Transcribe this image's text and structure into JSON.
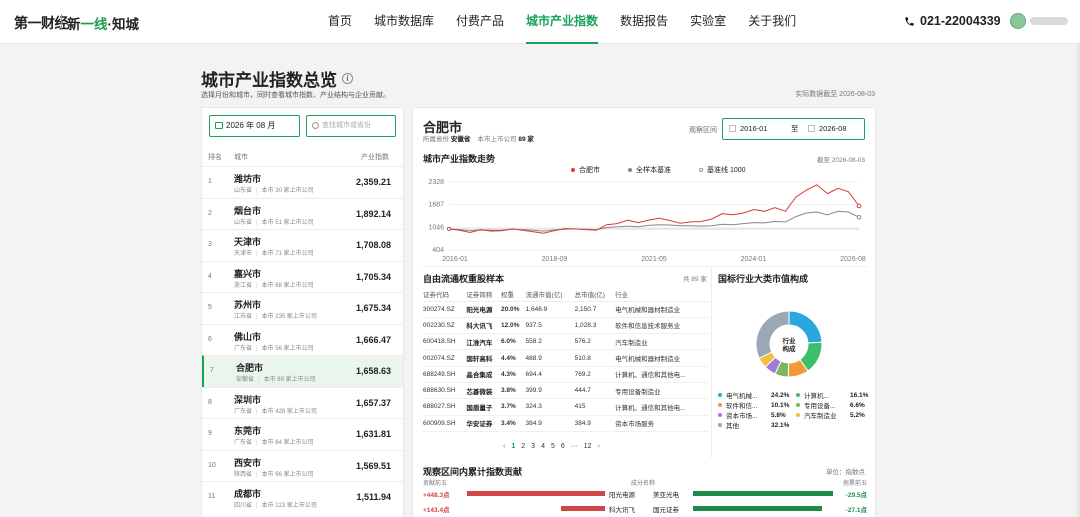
{
  "nav": {
    "logo_a": "第一财经",
    "logo_b_pre": "新",
    "logo_b_green": "一线",
    "logo_b_post": "·知城",
    "links": [
      "首页",
      "城市数据库",
      "付费产品",
      "城市产业指数",
      "数据报告",
      "实验室",
      "关于我们"
    ],
    "active_index": 3,
    "phone": "021-22004339"
  },
  "page": {
    "title": "城市产业指数总览",
    "subtitle": "选择月份和城市，同时查看城市指数、产业结构与企业贡献。",
    "data_date": "实际数据截至 2026-08-03"
  },
  "left": {
    "month": "2026 年 08 月",
    "search_placeholder": "查找城市或省份",
    "head": {
      "rank": "排名",
      "city": "城市",
      "index": "产业指数"
    },
    "rows": [
      {
        "rank": "1",
        "city": "潍坊市",
        "prov": "山东省",
        "count": "本市 30 家上市公司",
        "value": "2,359.21"
      },
      {
        "rank": "2",
        "city": "烟台市",
        "prov": "山东省",
        "count": "本市 51 家上市公司",
        "value": "1,892.14"
      },
      {
        "rank": "3",
        "city": "天津市",
        "prov": "天津市",
        "count": "本市 71 家上市公司",
        "value": "1,708.08"
      },
      {
        "rank": "4",
        "city": "嘉兴市",
        "prov": "浙江省",
        "count": "本市 68 家上市公司",
        "value": "1,705.34"
      },
      {
        "rank": "5",
        "city": "苏州市",
        "prov": "江苏省",
        "count": "本市 235 家上市公司",
        "value": "1,675.34"
      },
      {
        "rank": "6",
        "city": "佛山市",
        "prov": "广东省",
        "count": "本市 56 家上市公司",
        "value": "1,666.47"
      },
      {
        "rank": "7",
        "city": "合肥市",
        "prov": "安徽省",
        "count": "本市 89 家上市公司",
        "value": "1,658.63"
      },
      {
        "rank": "8",
        "city": "深圳市",
        "prov": "广东省",
        "count": "本市 428 家上市公司",
        "value": "1,657.37"
      },
      {
        "rank": "9",
        "city": "东莞市",
        "prov": "广东省",
        "count": "本市 64 家上市公司",
        "value": "1,631.81"
      },
      {
        "rank": "10",
        "city": "西安市",
        "prov": "陕西省",
        "count": "本市 66 家上市公司",
        "value": "1,569.51"
      },
      {
        "rank": "11",
        "city": "成都市",
        "prov": "四川省",
        "count": "本市 123 家上市公司",
        "value": "1,511.94"
      }
    ],
    "selected_index": 6
  },
  "right": {
    "city": "合肥市",
    "prov_label": "所属省份",
    "prov": "安徽省",
    "count_label": "本市上市公司",
    "count": "89 家",
    "obs_label": "观察区间",
    "start": "2016-01",
    "to": "至",
    "end": "2026-08",
    "trend_title": "城市产业指数走势",
    "trend_date": "截至 2026-08-03",
    "legend": [
      {
        "name": "合肥市",
        "color": "#d63b3b"
      },
      {
        "name": "全样本基准",
        "color": "#888888"
      },
      {
        "name": "基准线 1000",
        "color": "#bbbbbb"
      }
    ],
    "stocks_title": "自由流通权重股样本",
    "stocks_count": "共 89 家",
    "stock_head": [
      "证券代码",
      "证券简称",
      "权重",
      "流通市值(亿)",
      "总市值(亿)",
      "行业"
    ],
    "stocks": [
      [
        "300274.SZ",
        "阳光电源",
        "20.0%",
        "1,646.9",
        "2,150.7",
        "电气机械和器材制造业"
      ],
      [
        "002230.SZ",
        "科大讯飞",
        "12.0%",
        "937.5",
        "1,028.3",
        "软件和信息技术服务业"
      ],
      [
        "600418.SH",
        "江淮汽车",
        "6.0%",
        "558.2",
        "576.2",
        "汽车制造业"
      ],
      [
        "002074.SZ",
        "国轩高科",
        "4.4%",
        "488.9",
        "510.8",
        "电气机械和器材制造业"
      ],
      [
        "688249.SH",
        "晶合集成",
        "4.3%",
        "694.4",
        "769.2",
        "计算机、通信和其他电..."
      ],
      [
        "688630.SH",
        "芯碁微装",
        "3.8%",
        "399.9",
        "444.7",
        "专用设备制造业"
      ],
      [
        "688027.SH",
        "国盾量子",
        "3.7%",
        "324.3",
        "415",
        "计算机、通信和其他电..."
      ],
      [
        "600909.SH",
        "华安证券",
        "3.4%",
        "384.9",
        "384.9",
        "资本市场服务"
      ]
    ],
    "pages": [
      "‹",
      "1",
      "2",
      "3",
      "4",
      "5",
      "6",
      "···",
      "12",
      "›"
    ],
    "industry_title": "国标行业大类市值构成",
    "donut_center": "行业\n构成"
  },
  "chart_data": [
    {
      "type": "line",
      "title": "城市产业指数走势",
      "x_ticks": [
        "2016-01",
        "2018-09",
        "2021-05",
        "2024-01",
        "2026-08"
      ],
      "y_ticks": [
        2328,
        1687,
        1046,
        404
      ],
      "ylim": [
        404,
        2328
      ],
      "series": [
        {
          "name": "合肥市",
          "values": [
            1000,
            960,
            900,
            980,
            940,
            950,
            1000,
            960,
            920,
            880,
            950,
            1010,
            1000,
            980,
            960,
            1120,
            1150,
            1250,
            1180,
            1250,
            1300,
            1240,
            1160,
            1200,
            1210,
            1280,
            1430,
            1400,
            1450,
            1550,
            1500,
            1600,
            1500,
            1900,
            2100,
            2250,
            2000,
            2150,
            2050,
            1650
          ]
        },
        {
          "name": "全样本基准",
          "values": [
            1000,
            980,
            950,
            970,
            960,
            960,
            990,
            980,
            960,
            940,
            970,
            990,
            1000,
            990,
            980,
            1040,
            1060,
            1080,
            1060,
            1100,
            1120,
            1110,
            1090,
            1090,
            1080,
            1090,
            1130,
            1120,
            1150,
            1180,
            1170,
            1210,
            1200,
            1350,
            1450,
            1480,
            1400,
            1500,
            1480,
            1330
          ]
        },
        {
          "name": "基准线 1000",
          "values": [
            1000,
            1000
          ]
        }
      ]
    },
    {
      "type": "pie",
      "title": "国标行业大类市值构成",
      "categories": [
        "电气机械...",
        "计算机...",
        "软件和信...",
        "专用设备...",
        "资本市场...",
        "汽车制造业",
        "其他"
      ],
      "values": [
        24.2,
        16.1,
        10.1,
        6.6,
        5.8,
        5.2,
        32.1
      ],
      "labels": [
        "24.2%",
        "16.1%",
        "10.1%",
        "6.6%",
        "5.8%",
        "5.2%",
        "32.1%"
      ],
      "colors": [
        "#29a8dd",
        "#3dbf6a",
        "#f19a38",
        "#7ab85f",
        "#a07cd6",
        "#f0c040",
        "#9aa7b4"
      ]
    }
  ],
  "contrib": {
    "title": "观察区间内累计指数贡献",
    "unit": "单位：指数点",
    "left_head": "贡献前五",
    "mid_head": "成分名称",
    "right_head": "拖累前五",
    "rows": [
      {
        "lv": "+448.3点",
        "lfrac": 1.0,
        "ln": "阳光电源",
        "rn": "美亚光电",
        "rfrac": 1.0,
        "rv": "-29.5点"
      },
      {
        "lv": "+143.4点",
        "lfrac": 0.32,
        "ln": "科大讯飞",
        "rn": "国元证券",
        "rfrac": 0.92,
        "rv": "-27.1点"
      }
    ]
  }
}
